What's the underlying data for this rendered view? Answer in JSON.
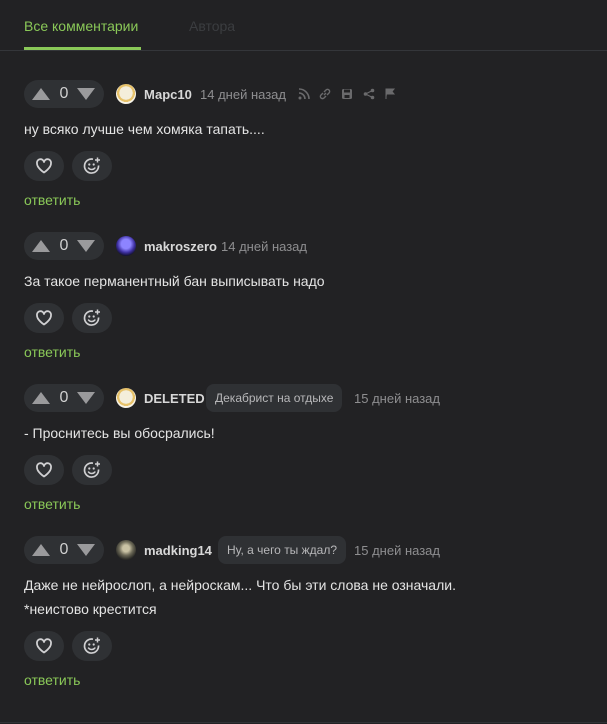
{
  "tabs": {
    "all": "Все комментарии",
    "author": "Автора"
  },
  "comments": [
    {
      "score": "0",
      "username": "Марс10",
      "time": "14 дней назад",
      "lines": [
        "ну всяко лучше чем хомяка тапать...."
      ],
      "reply": "ответить",
      "avatar": "cat-avatar"
    },
    {
      "score": "0",
      "username": "makroszero",
      "time": "14 дней назад",
      "lines": [
        "За такое перманентный бан выписывать надо"
      ],
      "reply": "ответить",
      "avatar": "dark-avatar"
    },
    {
      "score": "0",
      "username": "DELETED",
      "badge": "Декабрист на отдыхе",
      "time": "15 дней назад",
      "lines": [
        "- Проснитесь вы обосрались!"
      ],
      "reply": "ответить",
      "avatar": "cat-avatar"
    },
    {
      "score": "0",
      "username": "madking14",
      "badge": "Ну, а чего ты ждал?",
      "time": "15 дней назад",
      "lines": [
        "Даже не нейрослоп, а нейроскам... Что бы эти слова не означали.",
        "*неистово крестится"
      ],
      "reply": "ответить",
      "avatar": "portrait-avatar"
    }
  ],
  "colors": {
    "accent": "#8ac858",
    "background": "#222224",
    "chip": "#2f3134"
  },
  "icons": [
    "arrow-up-icon",
    "arrow-down-icon",
    "rss-icon",
    "link-icon",
    "save-icon",
    "share-icon",
    "flag-icon",
    "heart-icon",
    "emoji-add-icon"
  ]
}
